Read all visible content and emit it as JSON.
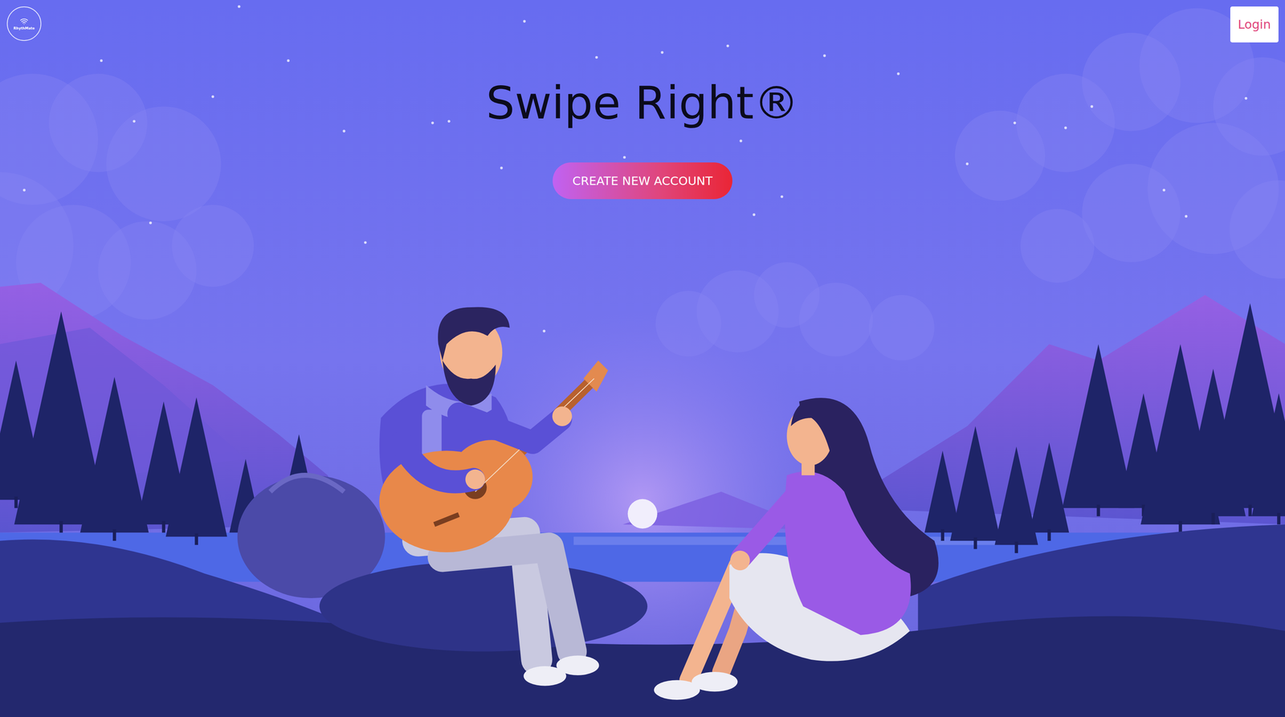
{
  "logo": {
    "text": "RhythMate"
  },
  "nav": {
    "login": "Login"
  },
  "hero": {
    "title": "Swipe Right®",
    "cta": "CREATE NEW ACCOUNT"
  }
}
